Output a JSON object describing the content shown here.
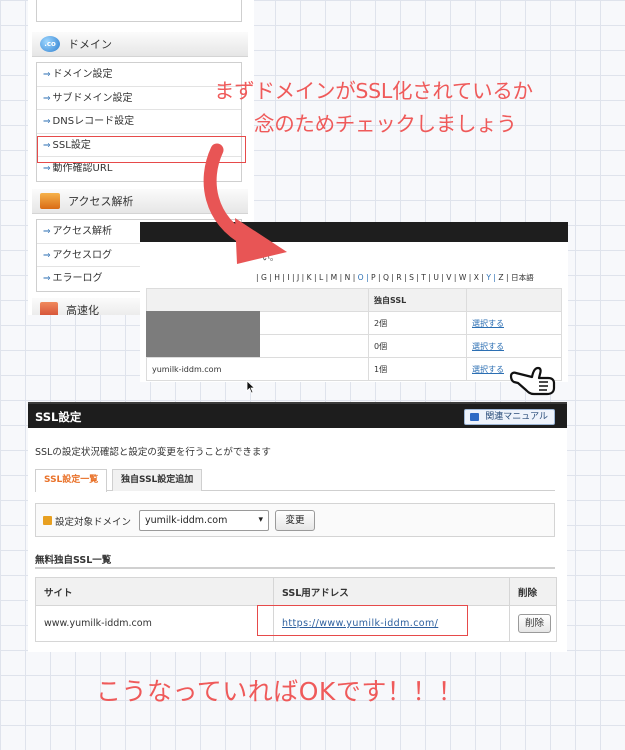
{
  "side_menu": {
    "domain_section_label": "ドメイン",
    "domain_items": [
      "ドメイン設定",
      "サブドメイン設定",
      "DNSレコード設定",
      "SSL設定",
      "動作確認URL"
    ],
    "access_section_label": "アクセス解析",
    "access_items": [
      "アクセス解析",
      "アクセスログ",
      "エラーログ"
    ],
    "next_section_label": "高速化"
  },
  "annotation": {
    "top_line1": "まずドメインがSSL化されているか",
    "top_line2": "念のためチェックしましょう",
    "bottom": "こうなっていればOKです！！！"
  },
  "domain_list": {
    "note": "い。",
    "alphabet": [
      "G",
      "H",
      "I",
      "J",
      "K",
      "L",
      "M",
      "N",
      "O",
      "P",
      "Q",
      "R",
      "S",
      "T",
      "U",
      "V",
      "W",
      "X",
      "Y",
      "Z",
      "日本語"
    ],
    "alphabet_links": [
      "O",
      "Y"
    ],
    "header_ssl": "独自SSL",
    "rows": [
      {
        "domain": "",
        "ssl": "2個",
        "action": "選択する"
      },
      {
        "domain": "",
        "ssl": "0個",
        "action": "選択する"
      },
      {
        "domain": "yumilk-iddm.com",
        "ssl": "1個",
        "action": "選択する"
      }
    ]
  },
  "ssl_settings": {
    "title": "SSL設定",
    "manual_button": "関連マニュアル",
    "description": "SSLの設定状況確認と設定の変更を行うことができます",
    "tabs": [
      "SSL設定一覧",
      "独自SSL設定追加"
    ],
    "active_tab": "SSL設定一覧",
    "target_domain_label": "設定対象ドメイン",
    "selected_domain": "yumilk-iddm.com",
    "change_button": "変更",
    "free_ssl_heading": "無料独自SSL一覧",
    "table_headers": {
      "site": "サイト",
      "address": "SSL用アドレス",
      "delete": "削除"
    },
    "table_rows": [
      {
        "site": "www.yumilk-iddm.com",
        "address": "https://www.yumilk-iddm.com/",
        "delete": "削除"
      }
    ]
  },
  "colors": {
    "annotation_red": "#ef5a5a",
    "active_tab_orange": "#e9722a",
    "link_blue": "#2c6fb3",
    "header_dark": "#1d1d1d"
  },
  "icons": {
    "domain_section": "globe-icon",
    "access_section": "bar-chart-icon",
    "menu_item": "arrow-right-icon",
    "pointer": "pointing-hand-icon",
    "manual": "book-icon"
  }
}
